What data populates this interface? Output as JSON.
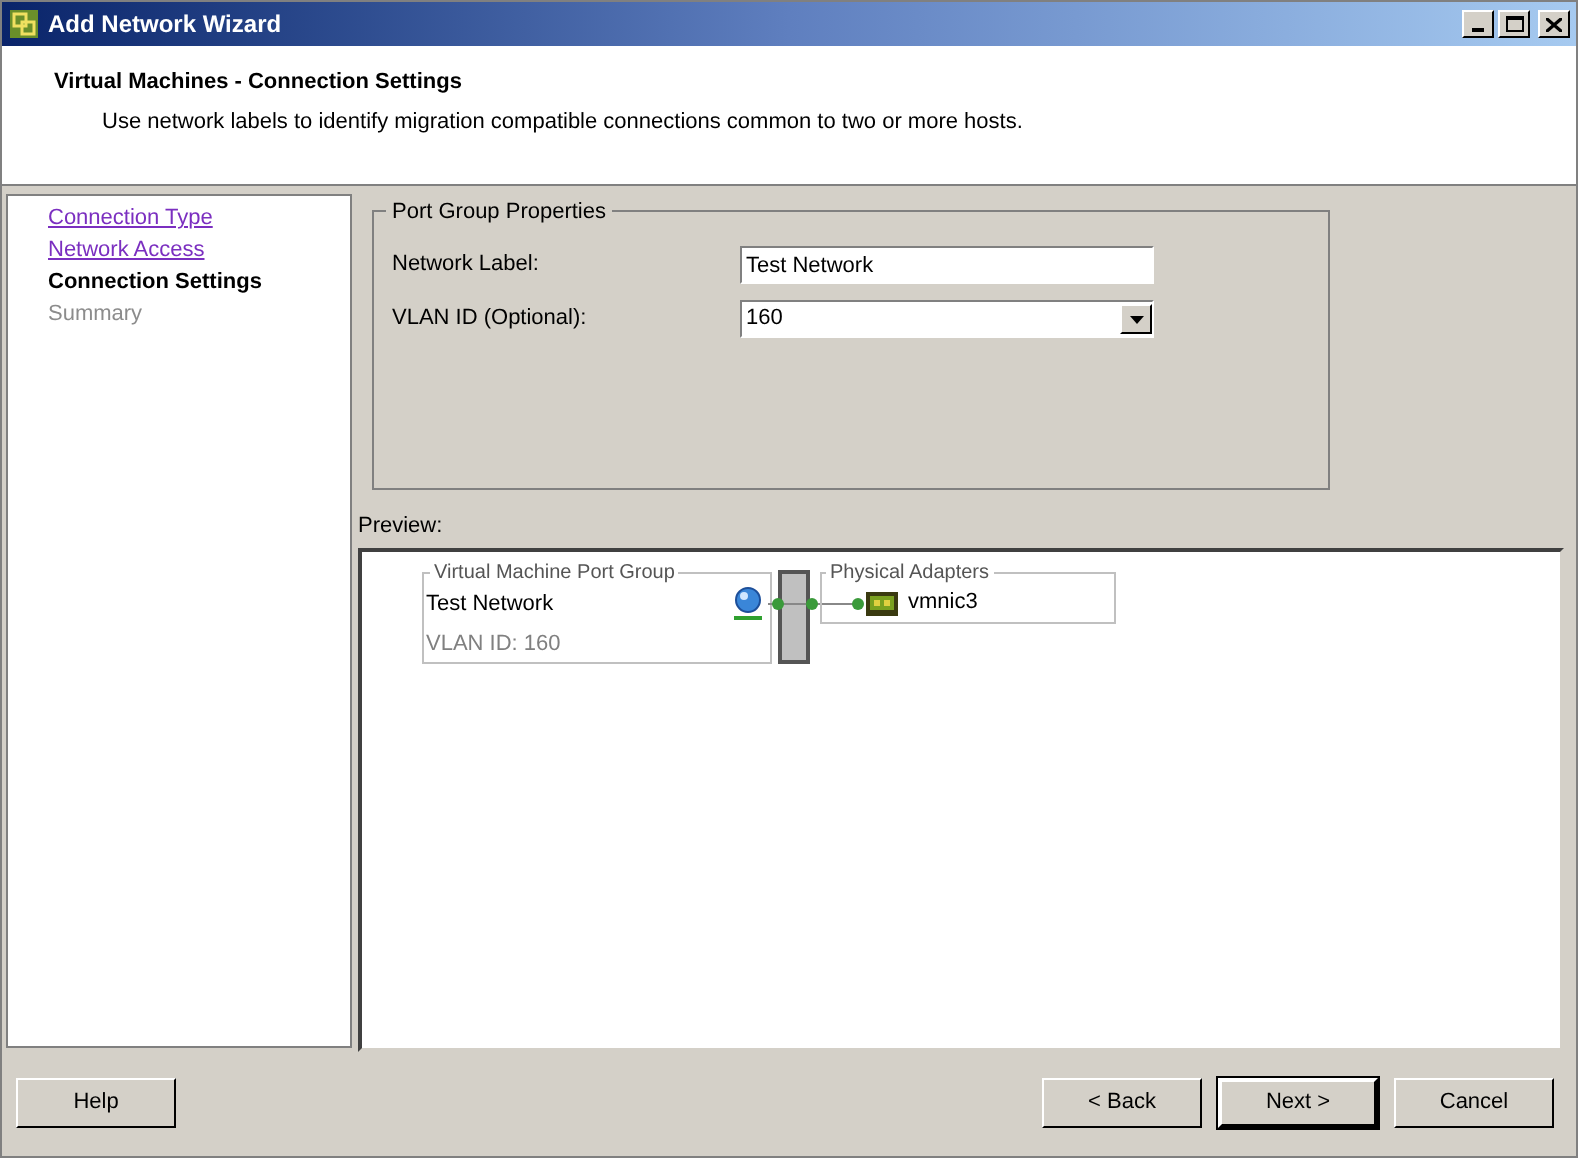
{
  "window": {
    "title": "Add Network Wizard"
  },
  "header": {
    "title": "Virtual Machines - Connection Settings",
    "subtitle": "Use network labels to identify migration compatible connections common to two or more hosts."
  },
  "steps": [
    {
      "label": "Connection Type",
      "kind": "link"
    },
    {
      "label": "Network Access",
      "kind": "link"
    },
    {
      "label": "Connection Settings",
      "kind": "current"
    },
    {
      "label": "Summary",
      "kind": "pending"
    }
  ],
  "port_group_properties": {
    "title": "Port Group Properties",
    "network_label": {
      "label": "Network Label:",
      "value": "Test Network"
    },
    "vlan_id": {
      "label": "VLAN ID (Optional):",
      "value": "160"
    }
  },
  "preview": {
    "label": "Preview:",
    "port_group": {
      "title": "Virtual Machine Port Group",
      "name": "Test Network",
      "vlan": "VLAN ID: 160"
    },
    "adapters": {
      "title": "Physical Adapters",
      "items": [
        "vmnic3"
      ]
    }
  },
  "buttons": {
    "help": "Help",
    "back": "< Back",
    "next": "Next >",
    "cancel": "Cancel"
  }
}
